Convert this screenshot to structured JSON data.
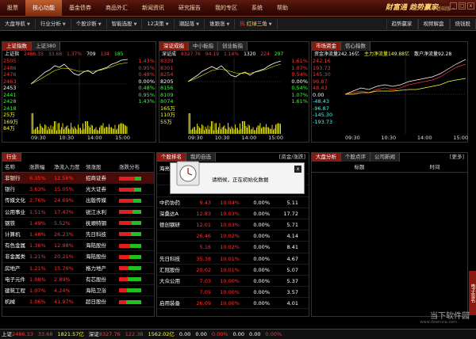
{
  "menu": {
    "items": [
      "股票",
      "核心功能",
      "基金债券",
      "商品外汇",
      "新闻资讯",
      "研究报告",
      "我的专区",
      "系统",
      "帮助"
    ],
    "active_index": 1,
    "brand": "财富通",
    "brand_title": "趋势赢家",
    "brand_edition": "基础版"
  },
  "toolbar": {
    "items": [
      "大盘导航",
      "行业分析",
      "个股诊断",
      "智能选股",
      "12决策",
      "潮起落",
      "谁跟涨",
      "红绿三角"
    ],
    "hot_icon": "热",
    "right_items": [
      "趋势赢家",
      "视频解盘",
      "烧钱股"
    ]
  },
  "sh_panel": {
    "tabs": [
      "上证指数",
      "上证380"
    ],
    "head_name": "上证指",
    "head_values": [
      "2486.33",
      "33.68",
      "1.37%",
      "709",
      "134",
      "185"
    ],
    "left_axis": [
      "2505",
      "2486",
      "2476",
      "2463",
      "2453",
      "2441",
      "2428",
      "2418",
      "25万",
      "169万",
      "84万"
    ],
    "right_axis": [
      "1.43%",
      "0.95%",
      "0.48%",
      "0.00%",
      "0.48%",
      "0.95%",
      "1.43%"
    ],
    "times": [
      "09:30",
      "10:30",
      "14:00",
      "15:00"
    ],
    "chart_data": {
      "type": "line",
      "x": [
        "09:30",
        "10:30",
        "14:00",
        "15:00"
      ],
      "price": [
        2453,
        2472,
        2460,
        2486
      ],
      "base": 2453,
      "ylim": [
        2418,
        2505
      ]
    }
  },
  "sz_panel": {
    "tabs": [
      "深证成指",
      "中小板指",
      "创业板指"
    ],
    "head_name": "深证成",
    "head_values": [
      "8327.76",
      "94.19",
      "1.14%",
      "1320",
      "224",
      "297"
    ],
    "left_axis": [
      "8339",
      "8301",
      "8254",
      "8205",
      "8156",
      "8109",
      "8074",
      "165万",
      "110万",
      "55万"
    ],
    "right_axis": [
      "1.61%",
      "1.07%",
      "0.54%",
      "0.00%",
      "0.54%",
      "1.07%",
      "1.61%"
    ],
    "times": [
      "09:30",
      "10:30",
      "14:00",
      "15:00"
    ]
  },
  "fund_panel": {
    "tabs": [
      "市场资金",
      "信心指数"
    ],
    "head": [
      "资金净流量242.16亿",
      "主力净流量149.88亿",
      "散户净流量92.28"
    ],
    "left_axis": [
      "242.16",
      "193.73",
      "145.30",
      "96.87",
      "48.43",
      "0.00",
      "-48.43",
      "-96.87",
      "-145.30",
      "-193.73"
    ],
    "times": [
      "09:30",
      "10:30",
      "14:00",
      "15:00"
    ]
  },
  "industry": {
    "tabs": [
      "行业"
    ],
    "headers": [
      "名称",
      "涨跌幅",
      "净流入力度",
      "领涨股",
      "涨跌分布"
    ],
    "rows": [
      {
        "name": "非银行",
        "chg": "6.35%",
        "flow": "12.56%",
        "lead": "招商证券"
      },
      {
        "name": "银行",
        "chg": "3.63%",
        "flow": "15.05%",
        "lead": "光大证券"
      },
      {
        "name": "传媒文化",
        "chg": "2.76%",
        "flow": "24.69%",
        "lead": "出版传媒"
      },
      {
        "name": "公用事业",
        "chg": "1.51%",
        "flow": "17.47%",
        "lead": "锐江水利"
      },
      {
        "name": "钢铁",
        "chg": "1.49%",
        "flow": "5.52%",
        "lead": "抚顺特钢"
      },
      {
        "name": "计算机",
        "chg": "1.48%",
        "flow": "26.23%",
        "lead": "先日科技"
      },
      {
        "name": "有色金属",
        "chg": "1.36%",
        "flow": "12.98%",
        "lead": "海陆股份"
      },
      {
        "name": "非金属类",
        "chg": "1.21%",
        "flow": "20.21%",
        "lead": "海陆股份"
      },
      {
        "name": "房地产",
        "chg": "1.21%",
        "flow": "15.79%",
        "lead": "格力地产"
      },
      {
        "name": "电子元件",
        "chg": "1.08%",
        "flow": "2.89%",
        "lead": "有芯股份"
      },
      {
        "name": "建筑工程",
        "chg": "1.07%",
        "flow": "4.24%",
        "lead": "海陆卫浴"
      },
      {
        "name": "机械",
        "chg": "1.06%",
        "flow": "41.97%",
        "lead": "超日股份"
      }
    ]
  },
  "stocks": {
    "tabs": [
      "个股排名",
      "我的自选"
    ],
    "tab_right": "[资金/涨跌]",
    "rows": [
      {
        "name": "海亮股份",
        "a": "",
        "b": "",
        "c": "",
        "d": ""
      },
      {
        "name": "",
        "a": "",
        "b": "",
        "c": "",
        "d": ""
      },
      {
        "name": "",
        "a": "",
        "b": "",
        "c": "",
        "d": ""
      },
      {
        "name": "中药协药",
        "a": "9.43",
        "b": "10.04%",
        "c": "0.00%",
        "d": "5.11"
      },
      {
        "name": "深桑达A",
        "a": "12.83",
        "b": "10.03%",
        "c": "0.00%",
        "d": "17.72"
      },
      {
        "name": "德创钢研",
        "a": "12.01",
        "b": "10.03%",
        "c": "0.00%",
        "d": "5.71"
      },
      {
        "name": "",
        "a": "26.46",
        "b": "10.02%",
        "c": "0.00%",
        "d": "4.14"
      },
      {
        "name": "",
        "a": "5.16",
        "b": "10.02%",
        "c": "0.00%",
        "d": "8.41"
      },
      {
        "name": "先日科技",
        "a": "35.38",
        "b": "10.01%",
        "c": "0.00%",
        "d": "4.67"
      },
      {
        "name": "汇冠股份",
        "a": "20.02",
        "b": "10.01%",
        "c": "0.00%",
        "d": "5.07"
      },
      {
        "name": "大众公用",
        "a": "7.03",
        "b": "10.00%",
        "c": "0.00%",
        "d": "5.37"
      },
      {
        "name": "",
        "a": "7.05",
        "b": "10.00%",
        "c": "0.00%",
        "d": "3.57"
      },
      {
        "name": "启用装备",
        "a": "26.09",
        "b": "10.00%",
        "c": "0.00%",
        "d": "4.01"
      }
    ]
  },
  "analysis": {
    "tabs": [
      "大盘分析",
      "个股点评",
      "公司新闻"
    ],
    "more": "[更多]",
    "headers": [
      "标题",
      "时间"
    ]
  },
  "dialog": {
    "text": "请稍候，正在初始化数据",
    "close": "x"
  },
  "side_tab": "电子签名",
  "status": {
    "items": [
      {
        "label": "上证",
        "val": "2486.33",
        "cls": "red"
      },
      {
        "label": "",
        "val": "33.68",
        "cls": "red"
      },
      {
        "label": "",
        "val": "1821.57亿",
        "cls": "yel"
      },
      {
        "label": "深证",
        "val": "8327.76",
        "cls": "red"
      },
      {
        "label": "",
        "val": "122.38",
        "cls": "red"
      },
      {
        "label": "",
        "val": "1562.02亿",
        "cls": "yel"
      },
      {
        "label": "",
        "val": "0.00",
        "cls": "white"
      },
      {
        "label": "",
        "val": "0.00",
        "cls": "white"
      },
      {
        "label": "",
        "val": "0.00%",
        "cls": "red"
      },
      {
        "label": "",
        "val": "0.00",
        "cls": "white"
      },
      {
        "label": "",
        "val": "0.00",
        "cls": "white"
      },
      {
        "label": "",
        "val": "0.00%",
        "cls": "red"
      }
    ]
  },
  "watermark": "当下软件园",
  "watermark_sub": "www.downxia.com"
}
